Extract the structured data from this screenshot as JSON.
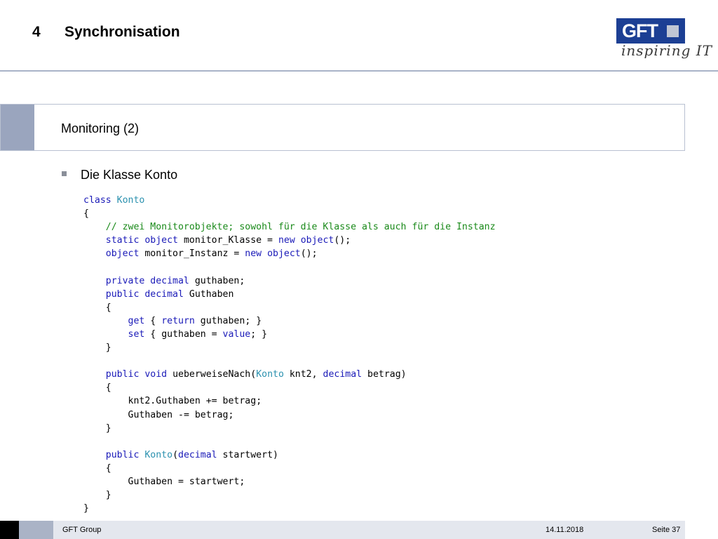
{
  "header": {
    "section_number": "4",
    "section_title": "Synchronisation"
  },
  "logo": {
    "brand": "GFT",
    "tagline": "inspiring IT"
  },
  "subtitle": "Monitoring (2)",
  "bullet": "Die Klasse Konto",
  "code": {
    "language": "C#",
    "lines": [
      "class Konto",
      "{",
      "    // zwei Monitorobjekte; sowohl für die Klasse als auch für die Instanz",
      "    static object monitor_Klasse = new object();",
      "    object monitor_Instanz = new object();",
      "",
      "    private decimal guthaben;",
      "    public decimal Guthaben",
      "    {",
      "        get { return guthaben; }",
      "        set { guthaben = value; }",
      "    }",
      "",
      "    public void ueberweiseNach(Konto knt2, decimal betrag)",
      "    {",
      "        knt2.Guthaben += betrag;",
      "        Guthaben -= betrag;",
      "    }",
      "",
      "    public Konto(decimal startwert)",
      "    {",
      "        Guthaben = startwert;",
      "    }",
      "}"
    ]
  },
  "footer": {
    "company": "GFT Group",
    "date": "14.11.2018",
    "page": "Seite 37"
  },
  "colors": {
    "brand_blue": "#1c3f94",
    "accent_grey": "#9aa5be",
    "keyword": "#1a1ab8",
    "type": "#2b91af",
    "comment": "#1a8a1a"
  }
}
